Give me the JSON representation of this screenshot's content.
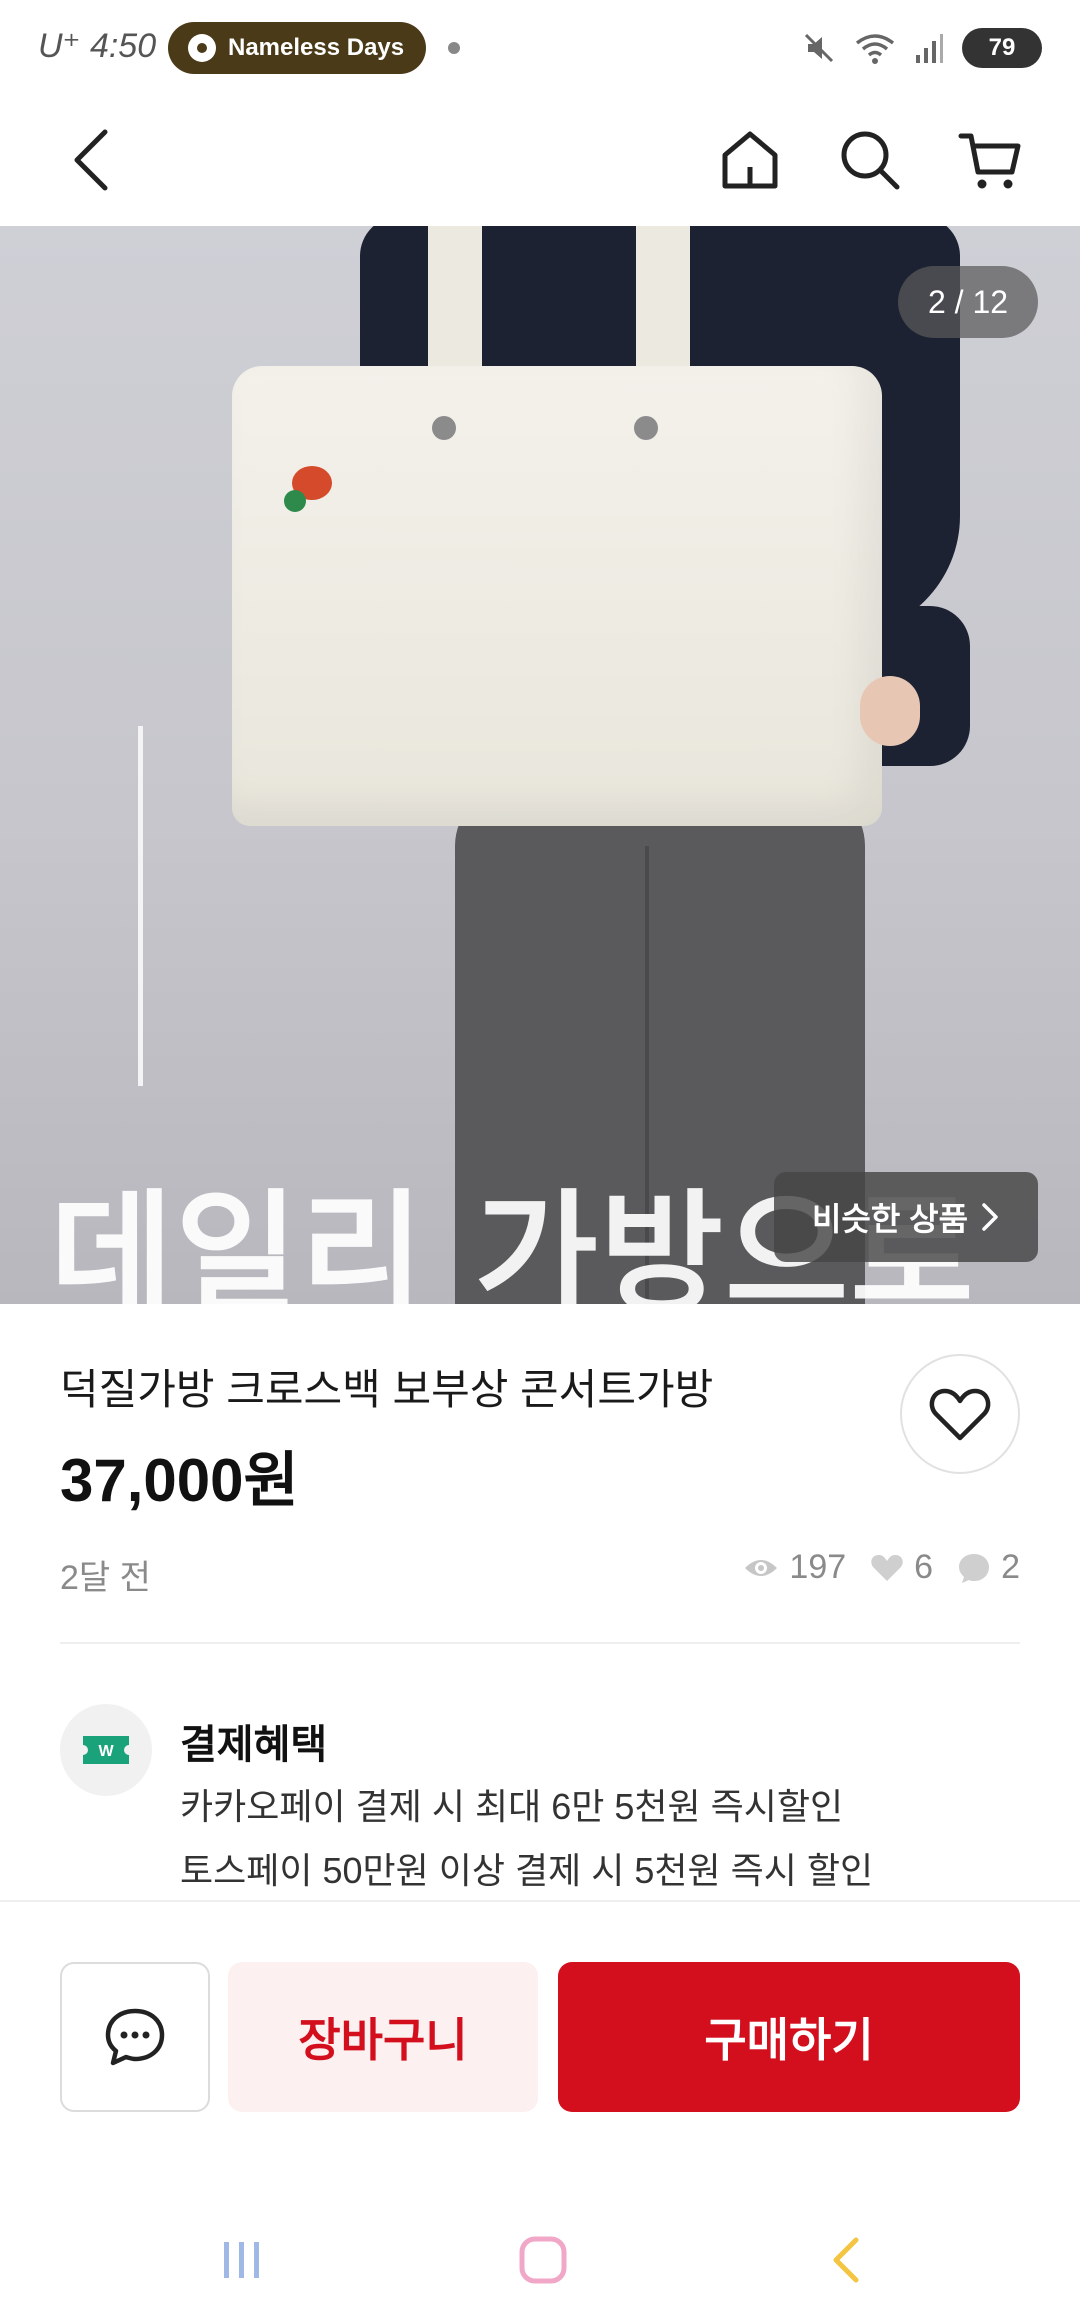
{
  "status_bar": {
    "carrier_time": "U⁺ 4:50",
    "now_playing": "Nameless Days",
    "battery": "79"
  },
  "top_nav": {
    "back_icon": "chevron-left-icon",
    "home_icon": "home-icon",
    "search_icon": "search-icon",
    "cart_icon": "cart-icon"
  },
  "hero": {
    "page_indicator": "2 / 12",
    "overlay_text": "데일리 가방으로",
    "similar_button": "비슷한 상품"
  },
  "product": {
    "title": "덕질가방 크로스백 보부상 콘서트가방",
    "price": "37,000원",
    "posted": "2달 전",
    "views": "197",
    "likes": "6",
    "chats": "2"
  },
  "benefits": {
    "title": "결제혜택",
    "lines": [
      "카카오페이 결제 시 최대 6만 5천원 즉시할인",
      "토스페이 50만원 이상 결제 시 5천원 즉시 할인"
    ]
  },
  "actions": {
    "cart_label": "장바구니",
    "buy_label": "구매하기"
  },
  "colors": {
    "accent": "#d30f1e",
    "accent_light": "#fdf0f0",
    "benefit_icon": "#1aa37a"
  }
}
